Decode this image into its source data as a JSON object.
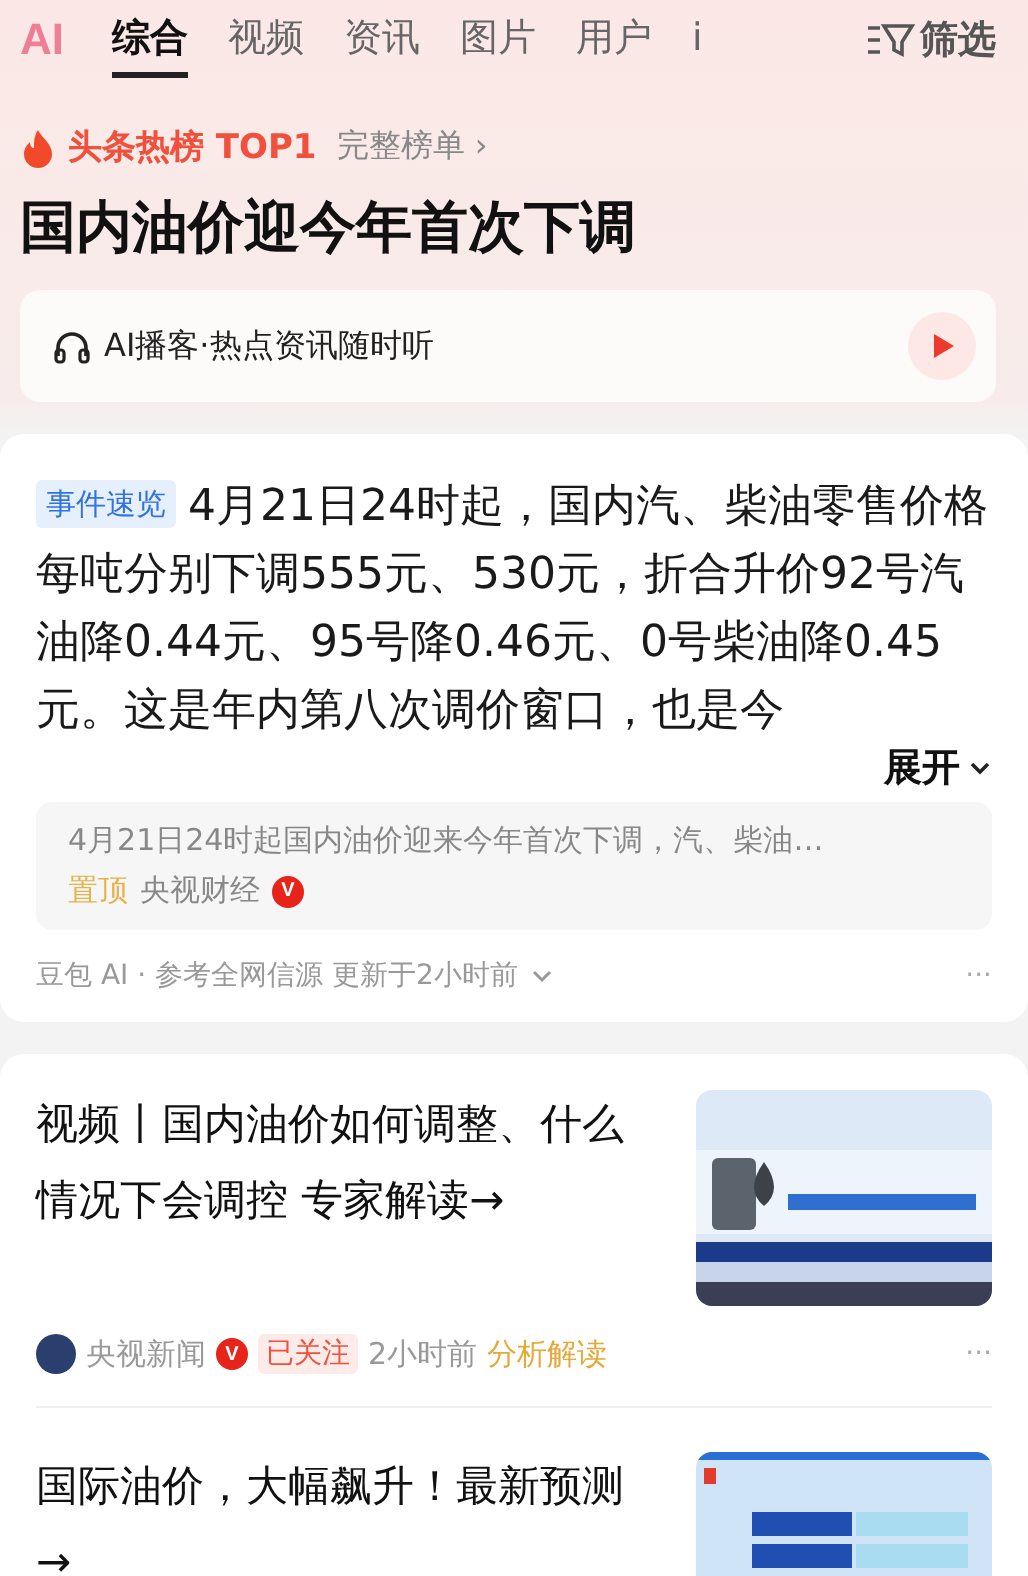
{
  "top_bar": {
    "logo": "AI",
    "tabs": [
      {
        "label": "综合",
        "selected": true
      },
      {
        "label": "视频",
        "selected": false
      },
      {
        "label": "资讯",
        "selected": false
      },
      {
        "label": "图片",
        "selected": false
      },
      {
        "label": "用户",
        "selected": false
      },
      {
        "label": "i",
        "selected": false
      }
    ],
    "filter": "筛选"
  },
  "hot": {
    "rank_label": "头条热榜 TOP1",
    "full_list": "完整榜单 ›",
    "headline": "国内油价迎今年首次下调",
    "podcast": "AI播客·热点资讯随时听"
  },
  "summary": {
    "tag": "事件速览",
    "text": "4月21日24时起，国内汽、柴油零售价格每吨分别下调555元、530元，折合升价92号汽油降0.44元、95号降0.46元、0号柴油降0.45元。这是年内第八次调价窗口，也是今",
    "expand": "展开",
    "source": {
      "title": "4月21日24时起国内油价迎来今年首次下调，汽、柴油…",
      "pin": "置顶",
      "author": "央视财经",
      "badge": "V"
    },
    "footer": "豆包 AI · 参考全网信源 更新于2小时前",
    "more": "···"
  },
  "articles": [
    {
      "title": "视频丨国内油价如何调整、什么情况下会调控 专家解读→",
      "meta": {
        "author": "央视新闻",
        "badge": "V",
        "followed": "已关注",
        "time": "2小时前",
        "tag": "分析解读",
        "more": "···"
      }
    },
    {
      "title": "国际油价，大幅飙升！最新预测→"
    }
  ]
}
